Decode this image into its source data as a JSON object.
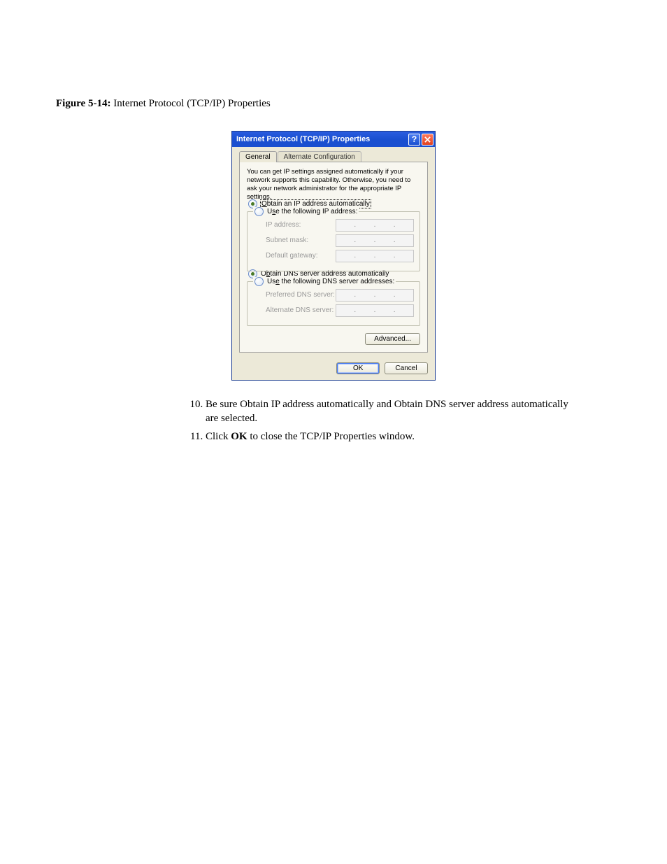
{
  "figure": {
    "label": "Figure 5-14:",
    "title": "Internet Protocol (TCP/IP) Properties"
  },
  "dialog": {
    "title": "Internet Protocol (TCP/IP) Properties",
    "tabs": {
      "general": "General",
      "alt": "Alternate Configuration"
    },
    "description": "You can get IP settings assigned automatically if your network supports this capability. Otherwise, you need to ask your network administrator for the appropriate IP settings.",
    "ip": {
      "auto_prefix": "O",
      "auto_rest": "btain an IP address automatically",
      "manual_pre": "U",
      "manual_mid": "s",
      "manual_post": "e the following IP address:",
      "fields": {
        "ip": "IP address:",
        "subnet": "Subnet mask:",
        "gateway": "Default gateway:"
      }
    },
    "dns": {
      "auto_pre": "O",
      "auto_mid": "b",
      "auto_post": "tain DNS server address automatically",
      "manual_pre": "Us",
      "manual_mid": "e",
      "manual_post": " the following DNS server addresses:",
      "fields": {
        "preferred": "Preferred DNS server:",
        "alternate": "Alternate DNS server:"
      }
    },
    "buttons": {
      "advanced_pre": "Ad",
      "advanced_mid": "v",
      "advanced_post": "anced...",
      "ok": "OK",
      "cancel": "Cancel"
    }
  },
  "steps": {
    "s10": "Be sure Obtain IP address automatically and Obtain DNS server address automatically are selected.",
    "s11_pre": "Click ",
    "s11_bold": "OK",
    "s11_post": " to close the TCP/IP Properties window."
  }
}
